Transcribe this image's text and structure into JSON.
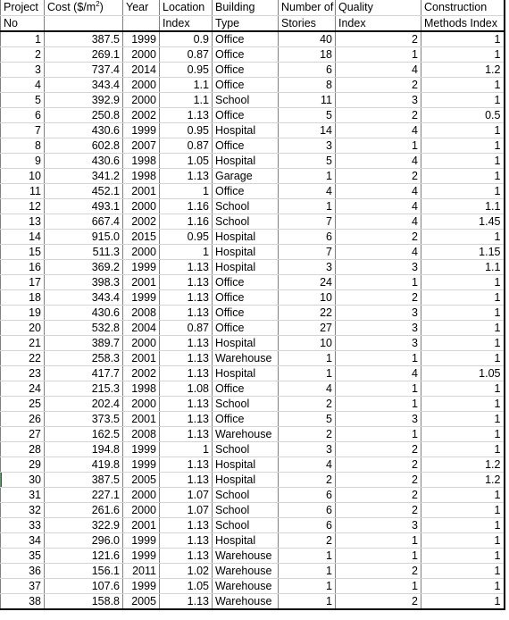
{
  "table": {
    "headers": [
      {
        "line1": "Project",
        "line2": "No",
        "align": "left"
      },
      {
        "line1": "Cost ($/m²)",
        "line2": "",
        "align": "left"
      },
      {
        "line1": "Year",
        "line2": "",
        "align": "left"
      },
      {
        "line1": "Location",
        "line2": "Index",
        "align": "left"
      },
      {
        "line1": "Building",
        "line2": "Type",
        "align": "left"
      },
      {
        "line1": "Number of",
        "line2": "Stories",
        "align": "left"
      },
      {
        "line1": "Quality",
        "line2": "Index",
        "align": "left"
      },
      {
        "line1": "Construction",
        "line2": "Methods Index",
        "align": "left"
      }
    ],
    "building_type_colors": {
      "Office": "#bde0e8",
      "School": "#cfc2de",
      "Hospital": "#d9e3b4",
      "Garage": "#eeb3ac",
      "Warehouse": "#fbe0c8"
    },
    "selection_accent_color": "#18682f",
    "selected_row_project_no": "30",
    "rows": [
      {
        "project_no": "1",
        "cost": "387.5",
        "year": "1999",
        "location_index": "0.9",
        "building_type": "Office",
        "stories": "40",
        "quality_index": "2",
        "construction_methods_index": "1"
      },
      {
        "project_no": "2",
        "cost": "269.1",
        "year": "2000",
        "location_index": "0.87",
        "building_type": "Office",
        "stories": "18",
        "quality_index": "1",
        "construction_methods_index": "1"
      },
      {
        "project_no": "3",
        "cost": "737.4",
        "year": "2014",
        "location_index": "0.95",
        "building_type": "Office",
        "stories": "6",
        "quality_index": "4",
        "construction_methods_index": "1.2"
      },
      {
        "project_no": "4",
        "cost": "343.4",
        "year": "2000",
        "location_index": "1.1",
        "building_type": "Office",
        "stories": "8",
        "quality_index": "2",
        "construction_methods_index": "1"
      },
      {
        "project_no": "5",
        "cost": "392.9",
        "year": "2000",
        "location_index": "1.1",
        "building_type": "School",
        "stories": "11",
        "quality_index": "3",
        "construction_methods_index": "1"
      },
      {
        "project_no": "6",
        "cost": "250.8",
        "year": "2002",
        "location_index": "1.13",
        "building_type": "Office",
        "stories": "5",
        "quality_index": "2",
        "construction_methods_index": "0.5"
      },
      {
        "project_no": "7",
        "cost": "430.6",
        "year": "1999",
        "location_index": "0.95",
        "building_type": "Hospital",
        "stories": "14",
        "quality_index": "4",
        "construction_methods_index": "1"
      },
      {
        "project_no": "8",
        "cost": "602.8",
        "year": "2007",
        "location_index": "0.87",
        "building_type": "Office",
        "stories": "3",
        "quality_index": "1",
        "construction_methods_index": "1"
      },
      {
        "project_no": "9",
        "cost": "430.6",
        "year": "1998",
        "location_index": "1.05",
        "building_type": "Hospital",
        "stories": "5",
        "quality_index": "4",
        "construction_methods_index": "1"
      },
      {
        "project_no": "10",
        "cost": "341.2",
        "year": "1998",
        "location_index": "1.13",
        "building_type": "Garage",
        "stories": "1",
        "quality_index": "2",
        "construction_methods_index": "1"
      },
      {
        "project_no": "11",
        "cost": "452.1",
        "year": "2001",
        "location_index": "1",
        "building_type": "Office",
        "stories": "4",
        "quality_index": "4",
        "construction_methods_index": "1"
      },
      {
        "project_no": "12",
        "cost": "493.1",
        "year": "2000",
        "location_index": "1.16",
        "building_type": "School",
        "stories": "1",
        "quality_index": "4",
        "construction_methods_index": "1.1"
      },
      {
        "project_no": "13",
        "cost": "667.4",
        "year": "2002",
        "location_index": "1.16",
        "building_type": "School",
        "stories": "7",
        "quality_index": "4",
        "construction_methods_index": "1.45"
      },
      {
        "project_no": "14",
        "cost": "915.0",
        "year": "2015",
        "location_index": "0.95",
        "building_type": "Hospital",
        "stories": "6",
        "quality_index": "2",
        "construction_methods_index": "1"
      },
      {
        "project_no": "15",
        "cost": "511.3",
        "year": "2000",
        "location_index": "1",
        "building_type": "Hospital",
        "stories": "7",
        "quality_index": "4",
        "construction_methods_index": "1.15"
      },
      {
        "project_no": "16",
        "cost": "369.2",
        "year": "1999",
        "location_index": "1.13",
        "building_type": "Hospital",
        "stories": "3",
        "quality_index": "3",
        "construction_methods_index": "1.1"
      },
      {
        "project_no": "17",
        "cost": "398.3",
        "year": "2001",
        "location_index": "1.13",
        "building_type": "Office",
        "stories": "24",
        "quality_index": "1",
        "construction_methods_index": "1"
      },
      {
        "project_no": "18",
        "cost": "343.4",
        "year": "1999",
        "location_index": "1.13",
        "building_type": "Office",
        "stories": "10",
        "quality_index": "2",
        "construction_methods_index": "1"
      },
      {
        "project_no": "19",
        "cost": "430.6",
        "year": "2008",
        "location_index": "1.13",
        "building_type": "Office",
        "stories": "22",
        "quality_index": "3",
        "construction_methods_index": "1"
      },
      {
        "project_no": "20",
        "cost": "532.8",
        "year": "2004",
        "location_index": "0.87",
        "building_type": "Office",
        "stories": "27",
        "quality_index": "3",
        "construction_methods_index": "1"
      },
      {
        "project_no": "21",
        "cost": "389.7",
        "year": "2000",
        "location_index": "1.13",
        "building_type": "Hospital",
        "stories": "10",
        "quality_index": "3",
        "construction_methods_index": "1"
      },
      {
        "project_no": "22",
        "cost": "258.3",
        "year": "2001",
        "location_index": "1.13",
        "building_type": "Warehouse",
        "stories": "1",
        "quality_index": "1",
        "construction_methods_index": "1"
      },
      {
        "project_no": "23",
        "cost": "417.7",
        "year": "2002",
        "location_index": "1.13",
        "building_type": "Hospital",
        "stories": "1",
        "quality_index": "4",
        "construction_methods_index": "1.05"
      },
      {
        "project_no": "24",
        "cost": "215.3",
        "year": "1998",
        "location_index": "1.08",
        "building_type": "Office",
        "stories": "4",
        "quality_index": "1",
        "construction_methods_index": "1"
      },
      {
        "project_no": "25",
        "cost": "202.4",
        "year": "2000",
        "location_index": "1.13",
        "building_type": "School",
        "stories": "2",
        "quality_index": "1",
        "construction_methods_index": "1"
      },
      {
        "project_no": "26",
        "cost": "373.5",
        "year": "2001",
        "location_index": "1.13",
        "building_type": "Office",
        "stories": "5",
        "quality_index": "3",
        "construction_methods_index": "1"
      },
      {
        "project_no": "27",
        "cost": "162.5",
        "year": "2008",
        "location_index": "1.13",
        "building_type": "Warehouse",
        "stories": "2",
        "quality_index": "1",
        "construction_methods_index": "1"
      },
      {
        "project_no": "28",
        "cost": "194.8",
        "year": "1999",
        "location_index": "1",
        "building_type": "School",
        "stories": "3",
        "quality_index": "2",
        "construction_methods_index": "1"
      },
      {
        "project_no": "29",
        "cost": "419.8",
        "year": "1999",
        "location_index": "1.13",
        "building_type": "Hospital",
        "stories": "4",
        "quality_index": "2",
        "construction_methods_index": "1.2"
      },
      {
        "project_no": "30",
        "cost": "387.5",
        "year": "2005",
        "location_index": "1.13",
        "building_type": "Hospital",
        "stories": "2",
        "quality_index": "2",
        "construction_methods_index": "1.2"
      },
      {
        "project_no": "31",
        "cost": "227.1",
        "year": "2000",
        "location_index": "1.07",
        "building_type": "School",
        "stories": "6",
        "quality_index": "2",
        "construction_methods_index": "1"
      },
      {
        "project_no": "32",
        "cost": "261.6",
        "year": "2000",
        "location_index": "1.07",
        "building_type": "School",
        "stories": "6",
        "quality_index": "2",
        "construction_methods_index": "1"
      },
      {
        "project_no": "33",
        "cost": "322.9",
        "year": "2001",
        "location_index": "1.13",
        "building_type": "School",
        "stories": "6",
        "quality_index": "3",
        "construction_methods_index": "1"
      },
      {
        "project_no": "34",
        "cost": "296.0",
        "year": "1999",
        "location_index": "1.13",
        "building_type": "Hospital",
        "stories": "2",
        "quality_index": "1",
        "construction_methods_index": "1"
      },
      {
        "project_no": "35",
        "cost": "121.6",
        "year": "1999",
        "location_index": "1.13",
        "building_type": "Warehouse",
        "stories": "1",
        "quality_index": "1",
        "construction_methods_index": "1"
      },
      {
        "project_no": "36",
        "cost": "156.1",
        "year": "2011",
        "location_index": "1.02",
        "building_type": "Warehouse",
        "stories": "1",
        "quality_index": "2",
        "construction_methods_index": "1"
      },
      {
        "project_no": "37",
        "cost": "107.6",
        "year": "1999",
        "location_index": "1.05",
        "building_type": "Warehouse",
        "stories": "1",
        "quality_index": "1",
        "construction_methods_index": "1"
      },
      {
        "project_no": "38",
        "cost": "158.8",
        "year": "2005",
        "location_index": "1.13",
        "building_type": "Warehouse",
        "stories": "1",
        "quality_index": "2",
        "construction_methods_index": "1"
      }
    ]
  }
}
